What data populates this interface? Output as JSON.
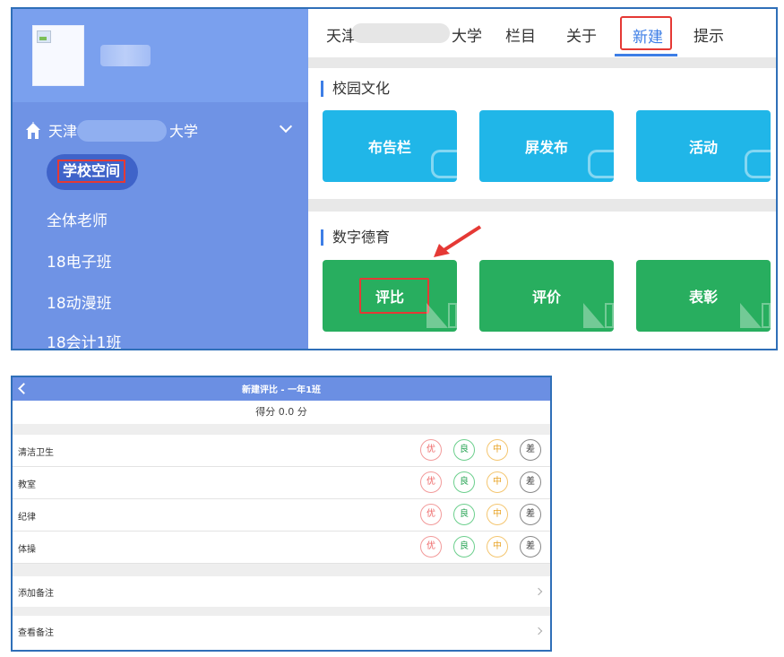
{
  "sidebar": {
    "school_name_prefix": "天津",
    "school_name_suffix": "大学",
    "active_item": "学校空间",
    "items": [
      "全体老师",
      "18电子班",
      "18动漫班",
      "18会计1班"
    ]
  },
  "topnav": {
    "item_school_prefix": "天津",
    "item_school_suffix": "大学",
    "item_columns": "栏目",
    "item_about": "关于",
    "item_new": "新建",
    "item_tips": "提示"
  },
  "sections": {
    "campus_culture": {
      "title": "校园文化",
      "tiles": [
        "布告栏",
        "屏发布",
        "活动"
      ]
    },
    "digital_moral": {
      "title": "数字德育",
      "tiles": [
        "评比",
        "评价",
        "表彰"
      ]
    }
  },
  "mobile": {
    "title": "新建评比 - 一年1班",
    "score_text": "得分 0.0 分",
    "grades": [
      "优",
      "良",
      "中",
      "差"
    ],
    "rows": [
      "清洁卫生",
      "教室",
      "纪律",
      "体操"
    ],
    "add_note": "添加备注",
    "view_note": "查看备注"
  },
  "colors": {
    "sidebar": "#6f93e5",
    "accent": "#3d7ee6",
    "tile_blue": "#20b6e8",
    "tile_green": "#28ae5f",
    "highlight_red": "#e53935"
  }
}
